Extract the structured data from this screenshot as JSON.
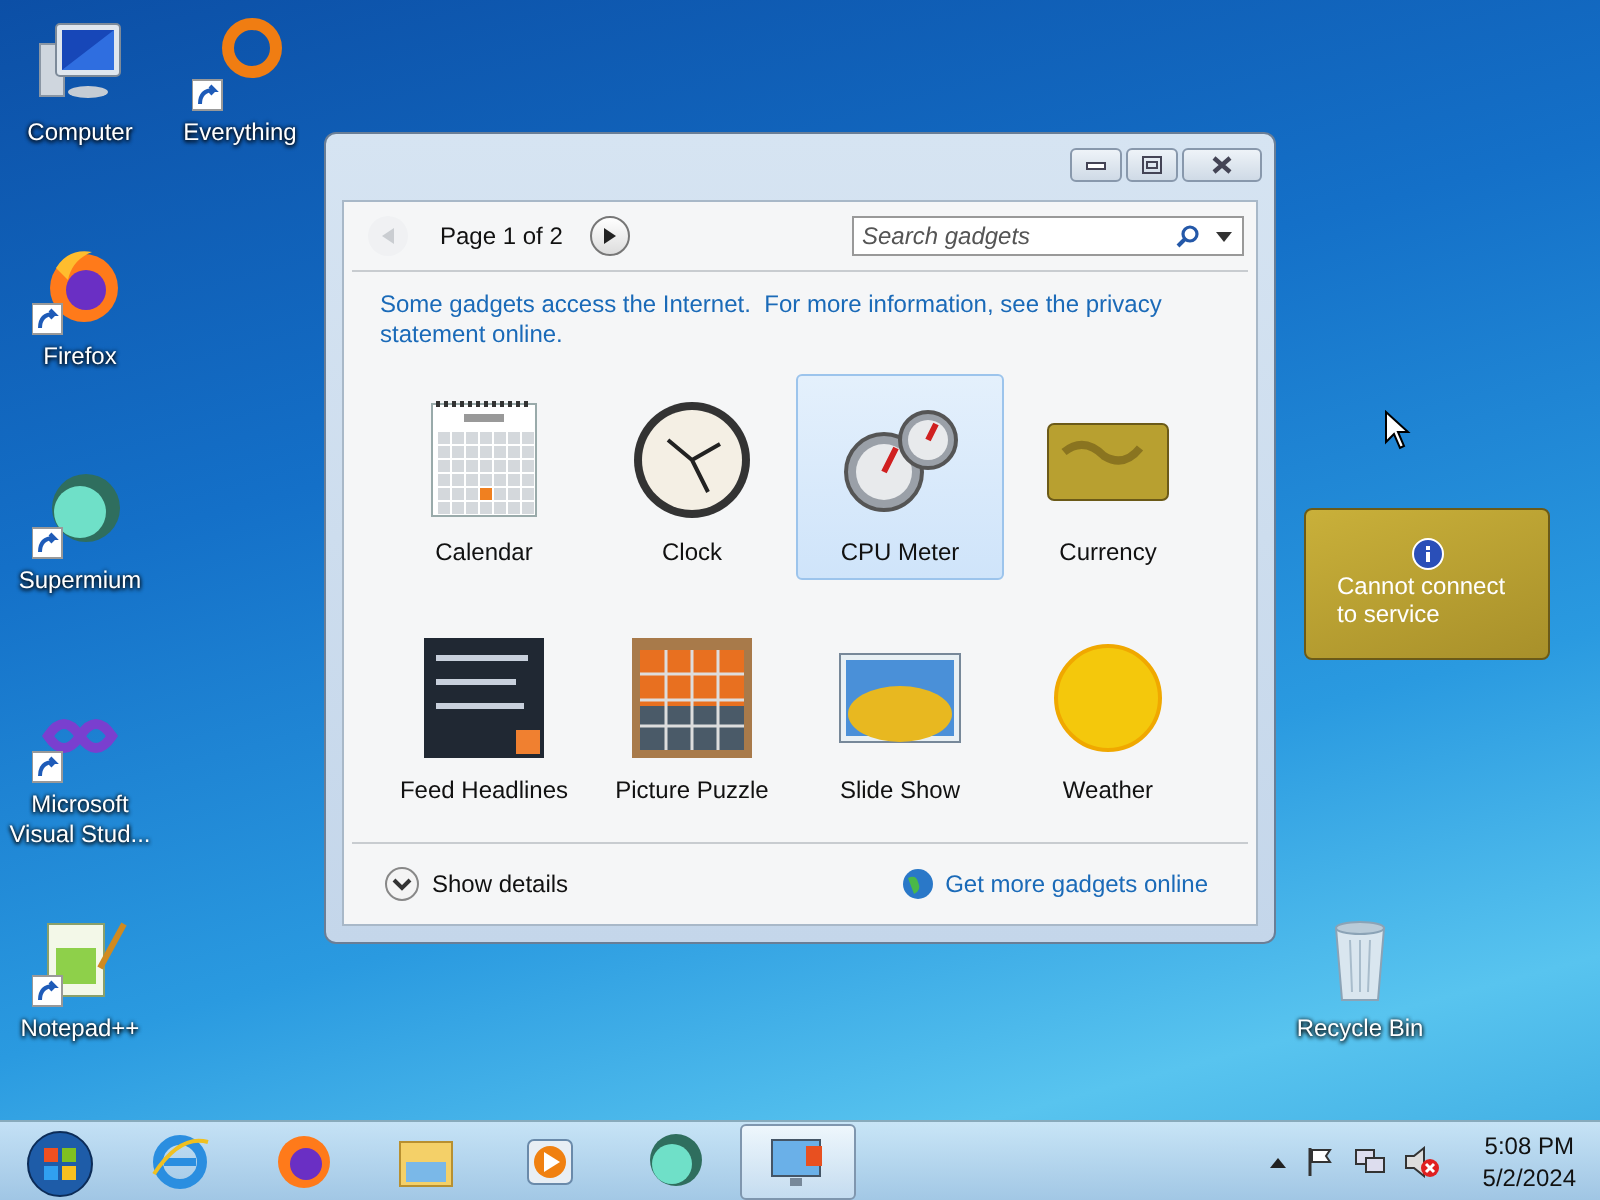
{
  "desktop_icons": [
    {
      "label": "Computer",
      "kind": "computer",
      "shortcut": false
    },
    {
      "label": "Everything",
      "kind": "everything",
      "shortcut": true
    },
    {
      "label": "Firefox",
      "kind": "firefox",
      "shortcut": true
    },
    {
      "label": "Supermium",
      "kind": "supermium",
      "shortcut": true
    },
    {
      "label": "Microsoft Visual Stud...",
      "kind": "visualstudio",
      "shortcut": true
    },
    {
      "label": "Notepad++",
      "kind": "notepad",
      "shortcut": true
    },
    {
      "label": "Recycle Bin",
      "kind": "recyclebin",
      "shortcut": false
    }
  ],
  "gadgets_window": {
    "pager": {
      "label": "Page 1 of 2",
      "prev_disabled": true,
      "next_disabled": false
    },
    "search": {
      "placeholder": "Search gadgets"
    },
    "notice": "Some gadgets access the Internet.  For more information, see the privacy statement online.",
    "gadgets": [
      {
        "label": "Calendar",
        "kind": "calendar",
        "selected": false
      },
      {
        "label": "Clock",
        "kind": "clock",
        "selected": false
      },
      {
        "label": "CPU Meter",
        "kind": "cpu",
        "selected": true
      },
      {
        "label": "Currency",
        "kind": "currency",
        "selected": false
      },
      {
        "label": "Feed Headlines",
        "kind": "feed",
        "selected": false
      },
      {
        "label": "Picture Puzzle",
        "kind": "puzzle",
        "selected": false
      },
      {
        "label": "Slide Show",
        "kind": "slideshow",
        "selected": false
      },
      {
        "label": "Weather",
        "kind": "weather",
        "selected": false
      }
    ],
    "details_button": "Show details",
    "more_link": "Get more gadgets online"
  },
  "currency_gadget": {
    "message": "Cannot connect to service"
  },
  "taskbar": {
    "apps": [
      {
        "kind": "ie",
        "selected": false
      },
      {
        "kind": "firefox",
        "selected": false
      },
      {
        "kind": "explorer",
        "selected": false
      },
      {
        "kind": "mediaplayer",
        "selected": false
      },
      {
        "kind": "supermium",
        "selected": false
      },
      {
        "kind": "gadgets",
        "selected": true
      }
    ],
    "clock": {
      "time": "5:08 PM",
      "date": "5/2/2024"
    }
  }
}
